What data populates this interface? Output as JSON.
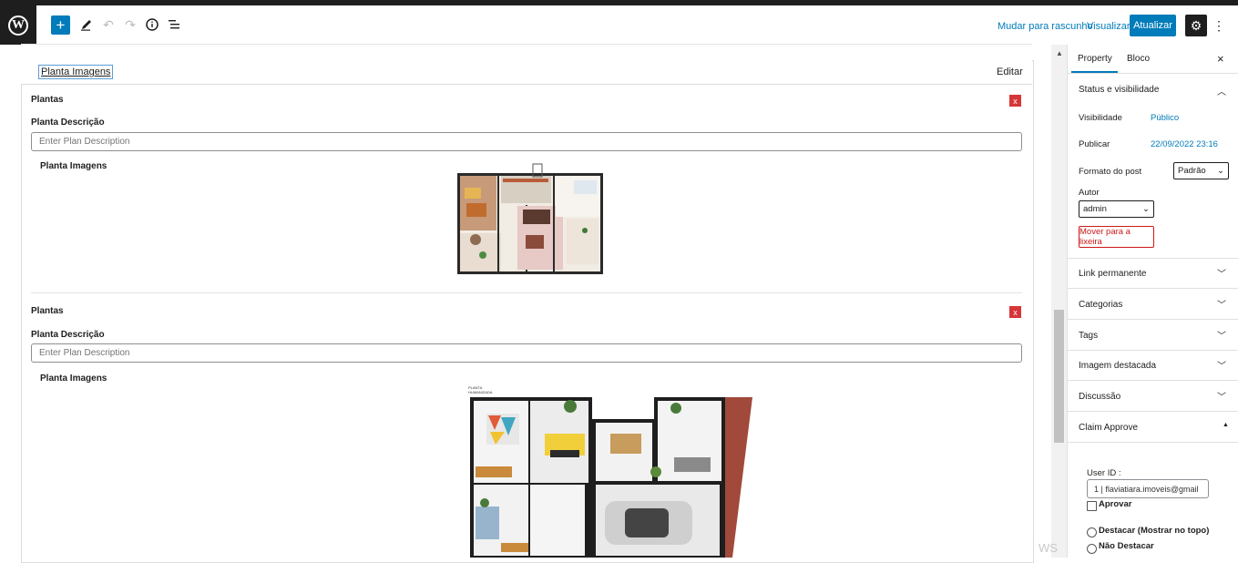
{
  "toolbar": {
    "add_label": "+",
    "draft_label": "Mudar para rascunho",
    "preview_label": "Visualizar",
    "update_label": "Atualizar"
  },
  "metabox": {
    "title": "Planta Imagens",
    "edit_label": "Editar",
    "plans": [
      {
        "section_label": "Plantas",
        "description_label": "Planta Descrição",
        "description_placeholder": "Enter Plan Description",
        "images_label": "Planta Imagens",
        "remove_label": "x"
      },
      {
        "section_label": "Plantas",
        "description_label": "Planta Descrição",
        "description_placeholder": "Enter Plan Description",
        "images_label": "Planta Imagens",
        "remove_label": "x",
        "image_caption": "PLANTA HUMANIZADA"
      }
    ]
  },
  "sidebar": {
    "tabs": {
      "property": "Property",
      "block": "Bloco"
    },
    "status": {
      "title": "Status e visibilidade",
      "visibility_label": "Visibilidade",
      "visibility_value": "Público",
      "publish_label": "Publicar",
      "publish_value": "22/09/2022 23:16",
      "format_label": "Formato do post",
      "format_value": "Padrão",
      "author_label": "Autor",
      "author_value": "admin",
      "trash_label": "Mover para a lixeira"
    },
    "panels": [
      "Link permanente",
      "Categorias",
      "Tags",
      "Imagem destacada",
      "Discussão"
    ],
    "claim": {
      "title": "Claim Approve",
      "user_id_label": "User ID :",
      "user_id_value": "1 | flaviatiara.imoveis@gmail",
      "approve_label": "Aprovar",
      "feature_top_label": "Destacar (Mostrar no topo)",
      "no_feature_label": "Não Destacar"
    }
  },
  "watermark": "WS",
  "colors": {
    "accent": "#007cba",
    "danger": "#d63638",
    "dark": "#1e1e1e"
  }
}
